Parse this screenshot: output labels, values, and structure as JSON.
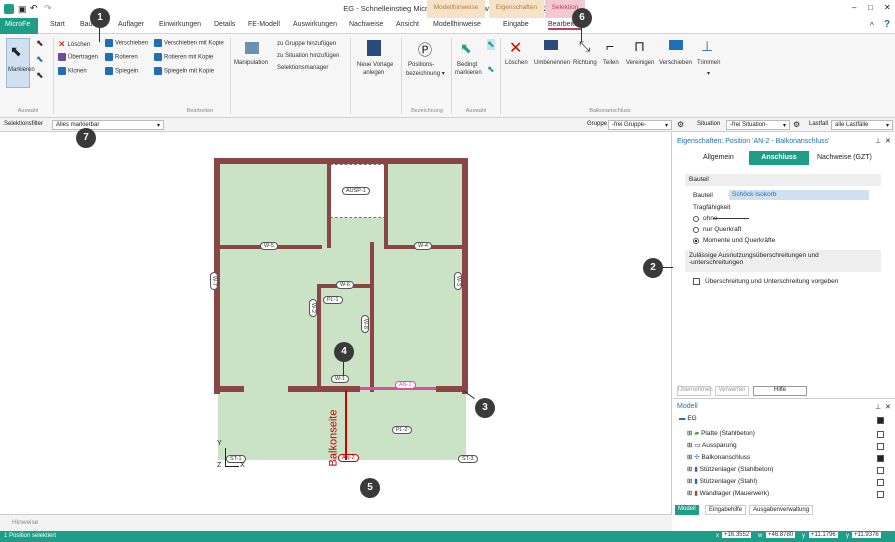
{
  "window": {
    "title": "EG - Schnelleinstieg MicroFe - Plattentragwerk - MicroFe 2022",
    "min": "–",
    "max": "□",
    "close": "✕",
    "help": "?",
    "collapse": "^"
  },
  "context_tabs": [
    "Modellhinweise",
    "Eigenschaften",
    "Selektion"
  ],
  "tabs": [
    "MicroFe",
    "Start",
    "Bauteile",
    "Auflager",
    "Einwirkungen",
    "Details",
    "FE-Modell",
    "Auswirkungen",
    "Nachweise",
    "Ansicht",
    "Modellhinweise",
    "Eingabe",
    "Bearbeiten"
  ],
  "ribbon": {
    "auswahl": {
      "label": "Auswahl",
      "markieren": "Markieren"
    },
    "bearbeiten": {
      "label": "Bearbeiten",
      "items": [
        "Löschen",
        "Übertragen",
        "Klonen",
        "Verschieben",
        "Rotieren",
        "Spiegeln",
        "Verschieben mit Kopie",
        "Rotieren mit Kopie",
        "Spiegeln mit Kopie"
      ]
    },
    "manipulation": "Manipulation",
    "gruppe": [
      "zu Gruppe hinzufügen",
      "zu Situation hinzufügen",
      "Selektionsmanager"
    ],
    "neue_vorlage": [
      "Neue Vorlage",
      "anlegen"
    ],
    "bezeichnung": {
      "label": "Bezeichnung",
      "btn": [
        "Positions-",
        "bezeichnung ▾"
      ]
    },
    "auswahl2": {
      "label": "Auswahl",
      "btn": [
        "Bedingt",
        "markieren"
      ]
    },
    "balkon": {
      "label": "Balkonanschluss",
      "items": [
        "Löschen",
        "Umbenennen",
        "Richtung",
        "Teilen",
        "Vereinigen",
        "Verschieben",
        "Trimmen"
      ]
    }
  },
  "filterbar": {
    "label": "Selektionsfilter",
    "value": "Alles markierbar",
    "gruppe_label": "Gruppe",
    "gruppe_value": "-frei Gruppe-",
    "situation_label": "Situation",
    "situation_value": "-frei Situation-",
    "lastfall_label": "Lastfall",
    "lastfall_value": "alle Lastfälle"
  },
  "props": {
    "title": "Eigenschaften: Position 'AN-2 - Balkonanschluss'",
    "tabs": [
      "Allgemein",
      "Anschluss",
      "Nachweise (GZT)"
    ],
    "section1": "Bauteil",
    "bauteil_label": "Bauteil",
    "bauteil_value": "Schöck Isokorb",
    "tragfaehigkeit": "Tragfähigkeit",
    "options": [
      "ohne",
      "nur Querkraft",
      "Momente und Querkräfte"
    ],
    "section2": [
      "Zulässige Ausnutzungsüberschreitungen und",
      "-unterschreitungen"
    ],
    "checkbox": "Überschreitung und Unterschreitung vorgeben",
    "buttons": [
      "Übernehmen",
      "Verwerfen",
      "Hilfe"
    ]
  },
  "model": {
    "title": "Modell",
    "root": "EG",
    "items": [
      "Platte (Stahlbeton)",
      "Aussparung",
      "Balkonanschluss",
      "Stützenlager (Stahlbeton)",
      "Stützenlager (Stahl)",
      "Wandlager (Mauerwerk)"
    ],
    "tabs": [
      "Modell",
      "Eingabehilfe",
      "Ausgabenverwaltung"
    ]
  },
  "drawing": {
    "labels": [
      "AUSP-1",
      "W-5",
      "W-4",
      "W-6",
      "W-7",
      "W-3",
      "PL-1",
      "W-2",
      "W-8",
      "W-1",
      "AN-1",
      "AN-2",
      "PL-2",
      "ST-1",
      "ST-2",
      "ST-3"
    ],
    "balkonseite": "Balkonseite",
    "axis_y": "Y",
    "axis_x": "X",
    "axis_z": "Z"
  },
  "callouts": [
    "1",
    "2",
    "3",
    "4",
    "5",
    "6",
    "7"
  ],
  "hinweise": "Hinweise",
  "status": {
    "text": "1 Position selektiert",
    "coords": [
      [
        "x",
        "+16.3552"
      ],
      [
        "w",
        "+46.8780"
      ],
      [
        "y",
        "+11.1796"
      ],
      [
        "y",
        "+11.9376"
      ]
    ]
  },
  "colors": {
    "accent": "#1e9e86",
    "wall": "#8b4545",
    "plate": "#c9e3c4"
  }
}
